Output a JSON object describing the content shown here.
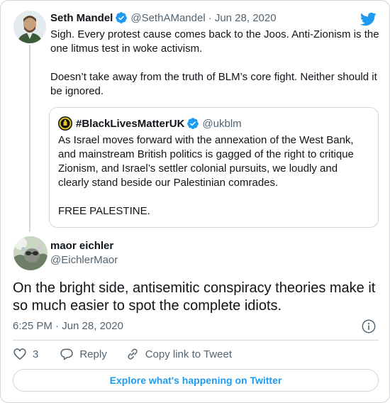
{
  "icons": {
    "brand": "twitter-bird-icon",
    "verified": "verified-badge-icon",
    "info": "info-icon",
    "like": "heart-icon",
    "reply": "reply-bubble-icon",
    "copy_link": "link-icon"
  },
  "colors": {
    "brand_blue": "#1d9bf0",
    "text": "#0f1419",
    "muted": "#536471",
    "border": "#cfd9de"
  },
  "parent_tweet": {
    "name": "Seth Mandel",
    "handle": "@SethAMandel",
    "date": "· Jun 28, 2020",
    "paragraphs": [
      "Sigh. Every protest cause comes back to the Joos. Anti-Zionism is the one litmus test in woke activism.",
      "Doesn’t take away from the truth of BLM’s core fight. Neither should it be ignored."
    ],
    "quoted": {
      "name": "#BlackLivesMatterUK",
      "handle": "@ukblm",
      "paragraphs": [
        "As Israel moves forward with the annexation of the West Bank, and mainstream British politics is gagged of the right to critique Zionism, and Israel’s settler colonial pursuits, we loudly and clearly stand beside our Palestinian comrades.",
        "FREE PALESTINE."
      ]
    }
  },
  "main_tweet": {
    "name": "maor eichler",
    "handle": "@EichlerMaor",
    "text": "On the bright side, antisemitic conspiracy theories make it so much easier to spot the complete idiots.",
    "timestamp": "6:25 PM · Jun 28, 2020",
    "like_count": "3",
    "reply_label": "Reply",
    "copy_link_label": "Copy link to Tweet"
  },
  "footer": {
    "explore_label": "Explore what's happening on Twitter"
  }
}
